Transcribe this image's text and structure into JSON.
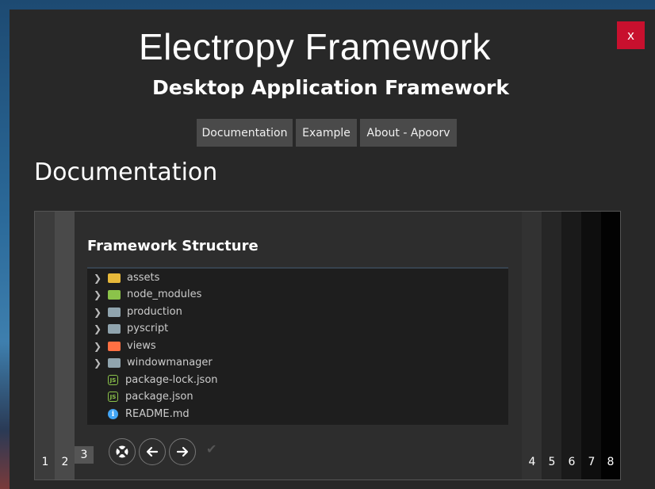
{
  "window": {
    "title": "Electropy Framework",
    "subtitle": "Desktop Application Framework",
    "close_label": "x"
  },
  "nav": [
    {
      "label": "Documentation"
    },
    {
      "label": "Example"
    },
    {
      "label": "About - Apoorv"
    }
  ],
  "section_title": "Documentation",
  "slide": {
    "title": "Framework Structure",
    "tree": [
      {
        "name": "assets",
        "kind": "folder",
        "icon": "assets-folder-icon",
        "color": "#e8b93a"
      },
      {
        "name": "node_modules",
        "kind": "folder",
        "icon": "node-modules-folder-icon",
        "color": "#8bc34a"
      },
      {
        "name": "production",
        "kind": "folder",
        "icon": "folder-icon",
        "color": "#90a4ae"
      },
      {
        "name": "pyscript",
        "kind": "folder",
        "icon": "folder-icon",
        "color": "#90a4ae"
      },
      {
        "name": "views",
        "kind": "folder",
        "icon": "views-folder-icon",
        "color": "#ff7043"
      },
      {
        "name": "windowmanager",
        "kind": "folder",
        "icon": "folder-icon",
        "color": "#90a4ae"
      },
      {
        "name": "package-lock.json",
        "kind": "file",
        "icon": "nodejs-icon",
        "color": "#8bc34a"
      },
      {
        "name": "package.json",
        "kind": "file",
        "icon": "nodejs-icon",
        "color": "#8bc34a"
      },
      {
        "name": "README.md",
        "kind": "file",
        "icon": "info-icon",
        "color": "#42a5f5"
      }
    ]
  },
  "controls": [
    {
      "name": "lifebuoy-button",
      "icon": "lifebuoy-icon"
    },
    {
      "name": "prev-button",
      "icon": "arrow-left-icon"
    },
    {
      "name": "next-button",
      "icon": "arrow-right-icon"
    }
  ],
  "pages_left": [
    "1",
    "2",
    "3"
  ],
  "pages_right": [
    "4",
    "5",
    "6",
    "7",
    "8"
  ],
  "colors": {
    "window_bg": "#282828",
    "close_bg": "#c8102e",
    "nav_bg": "#4a4a4a",
    "tree_bg": "#1e1e1e"
  }
}
